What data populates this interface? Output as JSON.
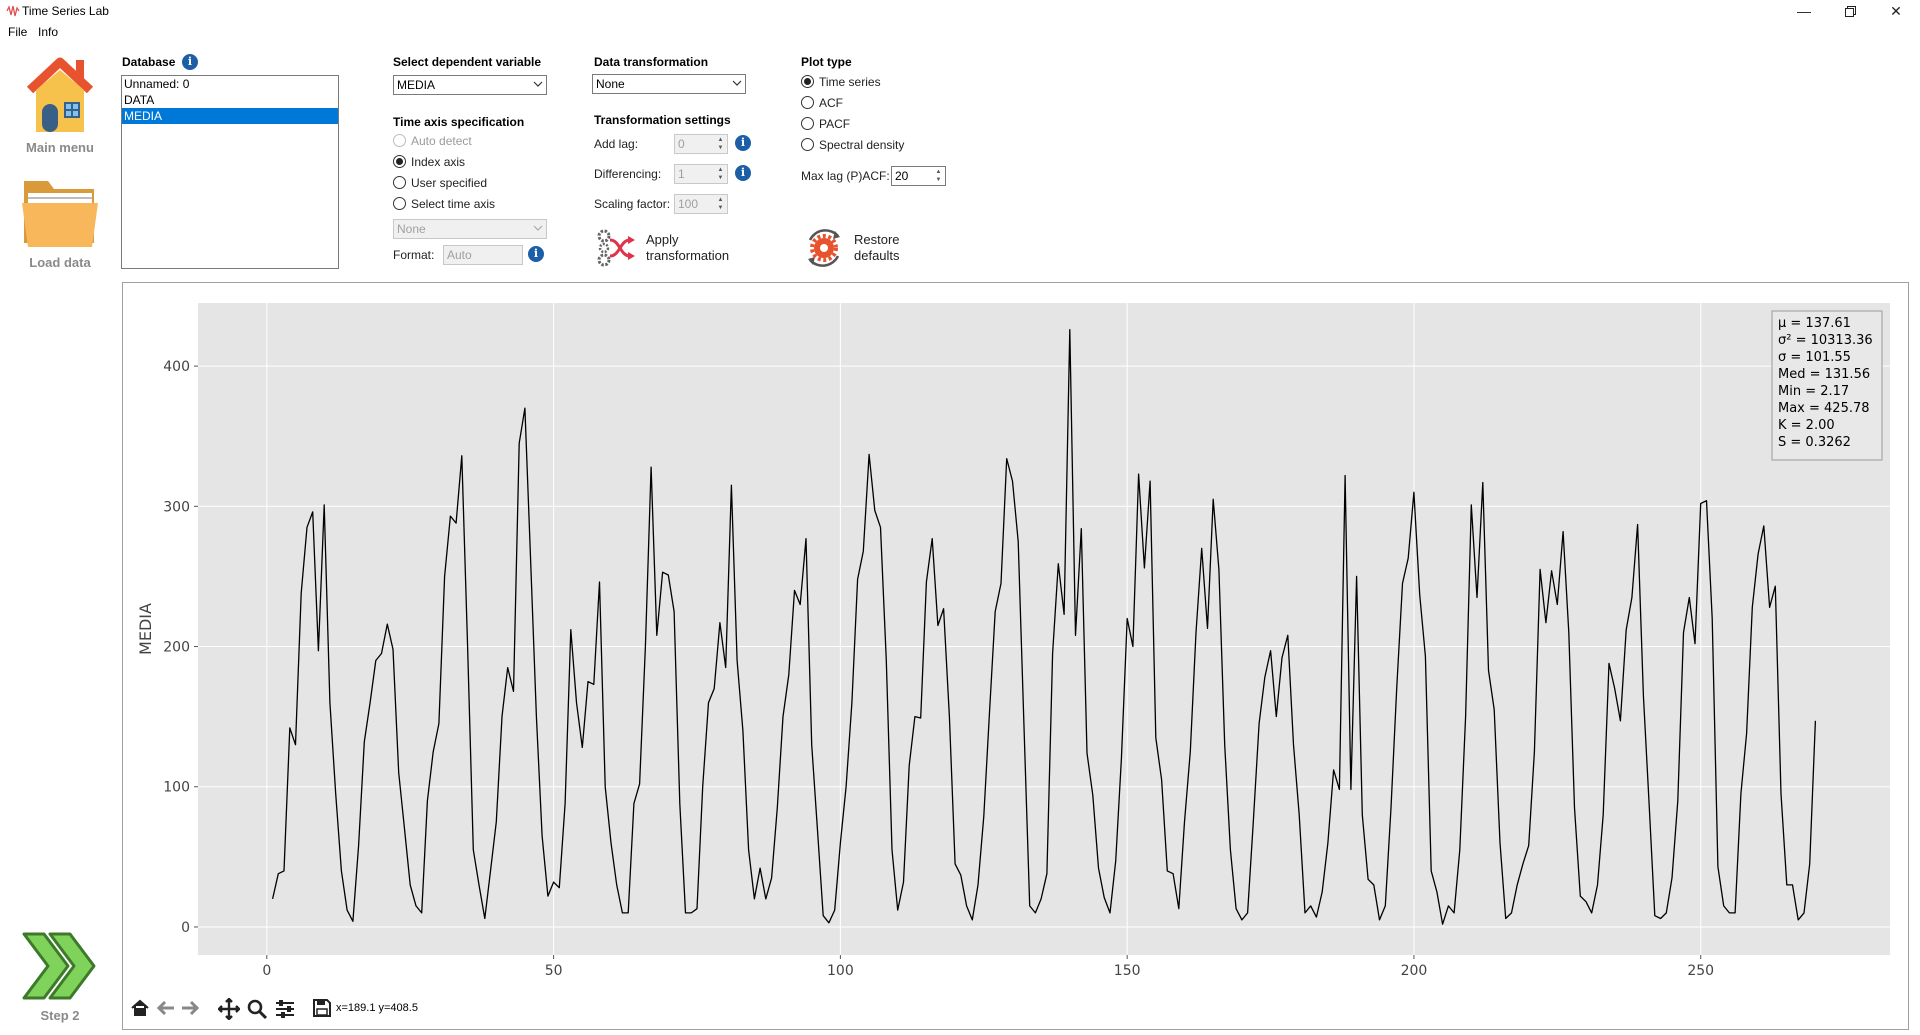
{
  "app": {
    "title": "Time Series Lab"
  },
  "menu": [
    "File",
    "Info"
  ],
  "nav": {
    "main_menu": "Main menu",
    "load_data": "Load data",
    "step2": "Step 2"
  },
  "database": {
    "heading": "Database",
    "items": [
      "Unnamed: 0",
      "DATA",
      "MEDIA"
    ],
    "selected": "MEDIA"
  },
  "dependent": {
    "heading": "Select dependent variable",
    "value": "MEDIA"
  },
  "time_axis": {
    "heading": "Time axis specification",
    "options": [
      "Auto detect",
      "Index axis",
      "User specified",
      "Select time axis"
    ],
    "selected": "Index axis",
    "select_value": "None",
    "format_label": "Format:",
    "format_value": "Auto"
  },
  "transform": {
    "heading": "Data transformation",
    "value": "None",
    "settings_heading": "Transformation settings",
    "add_lag_label": "Add lag:",
    "add_lag_value": "0",
    "differencing_label": "Differencing:",
    "differencing_value": "1",
    "scaling_label": "Scaling factor:",
    "scaling_value": "100",
    "apply_line1": "Apply",
    "apply_line2": "transformation"
  },
  "plot_type": {
    "heading": "Plot type",
    "options": [
      "Time series",
      "ACF",
      "PACF",
      "Spectral density"
    ],
    "selected": "Time series",
    "maxlag_label": "Max lag (P)ACF:",
    "maxlag_value": "20",
    "restore_line1": "Restore",
    "restore_line2": "defaults"
  },
  "stats": [
    "μ = 137.61",
    "σ² = 10313.36",
    "σ = 101.55",
    "Med = 131.56",
    "Min = 2.17",
    "Max = 425.78",
    "K = 2.00",
    "S = 0.3262"
  ],
  "toolbar": {
    "coords": "x=189.1 y=408.5"
  },
  "colors": {
    "accent": "#0078d7",
    "plot_bg": "#e5e5e5",
    "line": "#000000",
    "info": "#1d5fa6"
  },
  "chart_data": {
    "type": "line",
    "ylabel": "MEDIA",
    "xlabel": "",
    "xlim": [
      -12,
      283
    ],
    "ylim": [
      -20,
      445
    ],
    "xticks": [
      0,
      50,
      100,
      150,
      200,
      250
    ],
    "yticks": [
      0,
      100,
      200,
      300,
      400
    ],
    "grid": true,
    "x_start": 1,
    "series": [
      {
        "values": [
          20,
          38,
          40,
          142,
          130,
          238,
          285,
          296,
          197,
          301,
          160,
          95,
          40,
          12,
          4,
          58,
          132,
          160,
          190,
          195,
          216,
          198,
          110,
          70,
          30,
          15,
          10,
          90,
          125,
          145,
          250,
          293,
          288,
          336,
          200,
          55,
          30,
          6,
          40,
          75,
          150,
          185,
          168,
          345,
          370,
          260,
          150,
          65,
          22,
          32,
          28,
          88,
          212,
          160,
          128,
          175,
          173,
          246,
          100,
          60,
          30,
          10,
          10,
          88,
          102,
          200,
          328,
          208,
          253,
          251,
          225,
          88,
          10,
          10,
          13,
          100,
          160,
          170,
          217,
          185,
          315,
          190,
          140,
          55,
          20,
          42,
          20,
          35,
          85,
          150,
          180,
          240,
          230,
          277,
          130,
          70,
          8,
          3,
          12,
          60,
          100,
          160,
          248,
          268,
          337,
          297,
          285,
          190,
          55,
          12,
          32,
          115,
          150,
          149,
          246,
          277,
          215,
          227,
          150,
          45,
          37,
          15,
          5,
          30,
          79,
          153,
          225,
          245,
          334,
          318,
          275,
          145,
          15,
          10,
          20,
          38,
          195,
          259,
          223,
          426,
          208,
          284,
          124,
          94,
          42,
          21,
          10,
          47,
          120,
          220,
          200,
          323,
          256,
          318,
          135,
          105,
          40,
          38,
          13,
          75,
          125,
          210,
          270,
          213,
          305,
          255,
          130,
          55,
          13,
          5,
          10,
          75,
          145,
          178,
          197,
          150,
          192,
          208,
          130,
          80,
          10,
          15,
          7,
          25,
          60,
          112,
          98,
          322,
          98,
          250,
          80,
          34,
          30,
          5,
          15,
          85,
          170,
          245,
          263,
          310,
          237,
          193,
          40,
          25,
          2,
          15,
          10,
          55,
          150,
          301,
          235,
          317,
          183,
          155,
          60,
          6,
          10,
          30,
          45,
          58,
          125,
          255,
          217,
          254,
          230,
          282,
          210,
          85,
          22,
          18,
          10,
          30,
          80,
          188,
          170,
          147,
          212,
          235,
          287,
          165,
          88,
          8,
          6,
          10,
          35,
          90,
          210,
          235,
          202,
          302,
          304,
          220,
          43,
          15,
          10,
          10,
          95,
          138,
          228,
          266,
          286,
          228,
          243,
          95,
          30,
          30,
          5,
          10,
          45,
          147
        ]
      }
    ]
  }
}
